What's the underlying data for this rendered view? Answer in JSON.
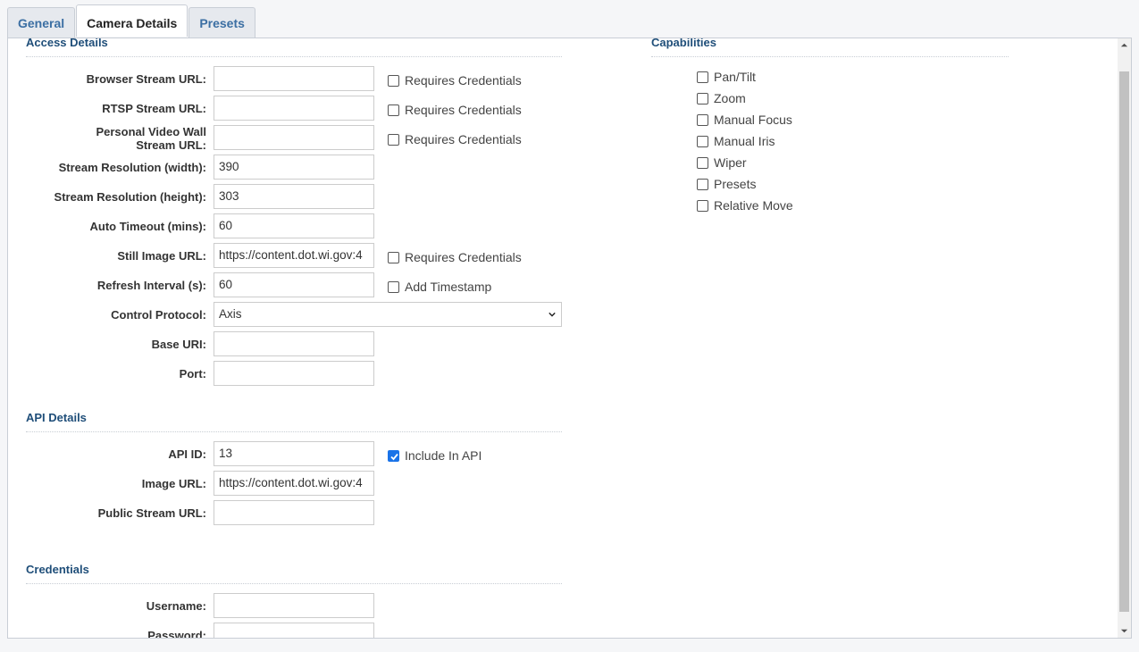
{
  "tabs": [
    {
      "label": "General",
      "active": false
    },
    {
      "label": "Camera Details",
      "active": true
    },
    {
      "label": "Presets",
      "active": false
    }
  ],
  "access": {
    "title": "Access Details",
    "browser_stream_url": {
      "label": "Browser Stream URL:",
      "value": "",
      "checkbox": "Requires Credentials",
      "checked": false
    },
    "rtsp_stream_url": {
      "label": "RTSP Stream URL:",
      "value": "",
      "checkbox": "Requires Credentials",
      "checked": false
    },
    "personal_video_wall": {
      "label_line1": "Personal Video Wall",
      "label_line2": "Stream URL:",
      "value": "",
      "checkbox": "Requires Credentials",
      "checked": false
    },
    "stream_width": {
      "label": "Stream Resolution (width):",
      "value": "390"
    },
    "stream_height": {
      "label": "Stream Resolution (height):",
      "value": "303"
    },
    "auto_timeout": {
      "label": "Auto Timeout (mins):",
      "value": "60"
    },
    "still_image_url": {
      "label": "Still Image URL:",
      "value": "https://content.dot.wi.gov:4",
      "checkbox": "Requires Credentials",
      "checked": false
    },
    "refresh_interval": {
      "label": "Refresh Interval (s):",
      "value": "60",
      "checkbox": "Add Timestamp",
      "checked": false
    },
    "control_protocol": {
      "label": "Control Protocol:",
      "value": "Axis"
    },
    "base_uri": {
      "label": "Base URI:",
      "value": ""
    },
    "port": {
      "label": "Port:",
      "value": ""
    }
  },
  "api": {
    "title": "API Details",
    "api_id": {
      "label": "API ID:",
      "value": "13",
      "checkbox": "Include In API",
      "checked": true
    },
    "image_url": {
      "label": "Image URL:",
      "value": "https://content.dot.wi.gov:4"
    },
    "public_stream_url": {
      "label": "Public Stream URL:",
      "value": ""
    }
  },
  "credentials": {
    "title": "Credentials",
    "username": {
      "label": "Username:",
      "value": ""
    },
    "password": {
      "label": "Password:",
      "value": ""
    }
  },
  "capabilities": {
    "title": "Capabilities",
    "items": [
      {
        "label": "Pan/Tilt",
        "checked": false
      },
      {
        "label": "Zoom",
        "checked": false
      },
      {
        "label": "Manual Focus",
        "checked": false
      },
      {
        "label": "Manual Iris",
        "checked": false
      },
      {
        "label": "Wiper",
        "checked": false
      },
      {
        "label": "Presets",
        "checked": false
      },
      {
        "label": "Relative Move",
        "checked": false
      }
    ]
  },
  "colors": {
    "accent": "#1a73e8",
    "section_title": "#1f4e79",
    "tab_text": "#3c6fa3"
  },
  "icons": {
    "select_arrow": "chevron-down-icon",
    "scroll_up": "scroll-up-arrow-icon",
    "scroll_down": "scroll-down-arrow-icon",
    "check": "check-icon"
  }
}
